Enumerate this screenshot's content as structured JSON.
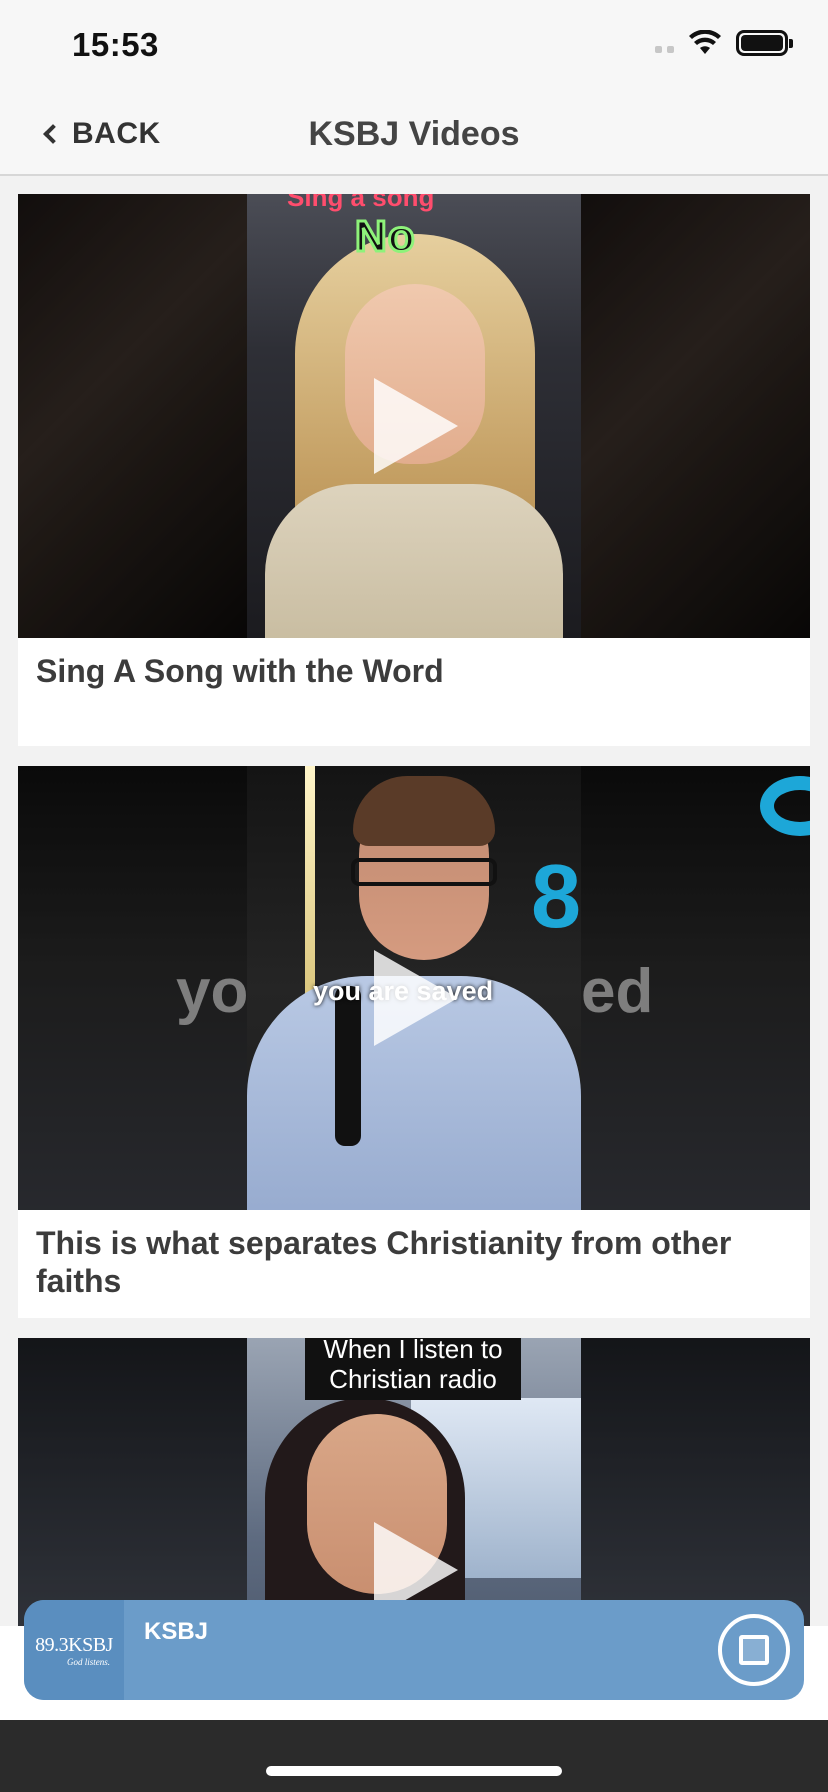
{
  "status_bar": {
    "time": "15:53",
    "icons": [
      "cellular-signal-icon",
      "wifi-icon",
      "battery-icon"
    ]
  },
  "nav": {
    "back_label": "BACK",
    "title": "KSBJ Videos"
  },
  "videos": [
    {
      "title": "Sing A Song with the Word",
      "thumbnail_caption": "No",
      "thumbnail_caption_top": "Sing a song"
    },
    {
      "title": "This is what separates Christianity from other faiths",
      "thumbnail_caption": "you are saved",
      "thumbnail_side_left": "yo",
      "thumbnail_side_right": "ed",
      "thumbnail_number": "8"
    },
    {
      "title": "",
      "thumbnail_caption": "When I listen to Christian radio"
    }
  ],
  "mini_player": {
    "logo_text": "89.3KSBJ",
    "logo_tagline": "God listens.",
    "station": "KSBJ",
    "control": "stop-icon"
  },
  "colors": {
    "player_bg": "#6b9cc9",
    "nav_bg": "#f7f7f7",
    "page_bg": "#f2f2f2"
  }
}
